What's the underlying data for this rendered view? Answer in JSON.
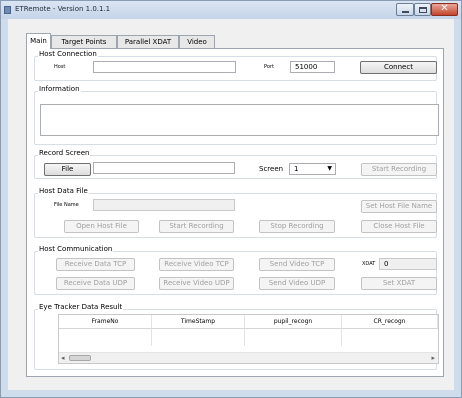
{
  "window": {
    "title": "ETRemote - Version 1.0.1.1",
    "icons": {
      "app": "app-icon",
      "minimize": "minimize-icon",
      "maximize": "maximize-icon",
      "close": "close-icon"
    },
    "close_glyph": "✕"
  },
  "tabs": [
    {
      "label": "Main",
      "active": true
    },
    {
      "label": "Target Points",
      "active": false
    },
    {
      "label": "Parallel XDAT",
      "active": false
    },
    {
      "label": "Video",
      "active": false
    }
  ],
  "host_connection": {
    "title": "Host Connection",
    "host_label": "Host",
    "host_value": "",
    "port_label": "Port",
    "port_value": "51000",
    "connect_label": "Connect"
  },
  "information": {
    "title": "Information",
    "text": ""
  },
  "record_screen": {
    "title": "Record Screen",
    "file_label": "File",
    "file_value": "",
    "screen_label": "Screen",
    "screen_value": "1",
    "start_recording_label": "Start Recording"
  },
  "host_data_file": {
    "title": "Host Data File",
    "file_name_label": "File Name",
    "file_name_value": "",
    "set_host_file_name_label": "Set Host File Name",
    "open_host_file_label": "Open Host File",
    "start_recording_label": "Start Recording",
    "stop_recording_label": "Stop Recording",
    "close_host_file_label": "Close Host File"
  },
  "host_communication": {
    "title": "Host Communication",
    "receive_data_tcp_label": "Receive Data TCP",
    "receive_video_tcp_label": "Receive Video TCP",
    "send_video_tcp_label": "Send Video TCP",
    "xdat_label": "XDAT",
    "xdat_value": "0",
    "receive_data_udp_label": "Receive Data UDP",
    "receive_video_udp_label": "Receive Video UDP",
    "send_video_udp_label": "Send Video UDP",
    "set_xdat_label": "Set XDAT"
  },
  "eye_tracker": {
    "title": "Eye Tracker Data Result",
    "columns": [
      "FrameNo",
      "TimeStamp",
      "pupil_recogn",
      "CR_recogn"
    ],
    "rows": [],
    "scroll_left": "◂",
    "scroll_right": "▸"
  },
  "colors": {
    "window_frame": "#cfdcec",
    "panel": "#ffffff",
    "close_button": "#c3442c",
    "group_border": "#d5dfe5"
  }
}
